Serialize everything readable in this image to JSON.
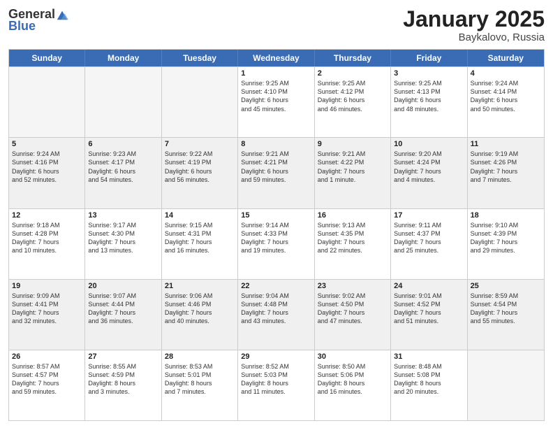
{
  "header": {
    "logo_general": "General",
    "logo_blue": "Blue",
    "month": "January 2025",
    "location": "Baykalovo, Russia"
  },
  "days_of_week": [
    "Sunday",
    "Monday",
    "Tuesday",
    "Wednesday",
    "Thursday",
    "Friday",
    "Saturday"
  ],
  "weeks": [
    [
      {
        "day": "",
        "info": "",
        "empty": true
      },
      {
        "day": "",
        "info": "",
        "empty": true
      },
      {
        "day": "",
        "info": "",
        "empty": true
      },
      {
        "day": "1",
        "info": "Sunrise: 9:25 AM\nSunset: 4:10 PM\nDaylight: 6 hours\nand 45 minutes."
      },
      {
        "day": "2",
        "info": "Sunrise: 9:25 AM\nSunset: 4:12 PM\nDaylight: 6 hours\nand 46 minutes."
      },
      {
        "day": "3",
        "info": "Sunrise: 9:25 AM\nSunset: 4:13 PM\nDaylight: 6 hours\nand 48 minutes."
      },
      {
        "day": "4",
        "info": "Sunrise: 9:24 AM\nSunset: 4:14 PM\nDaylight: 6 hours\nand 50 minutes."
      }
    ],
    [
      {
        "day": "5",
        "info": "Sunrise: 9:24 AM\nSunset: 4:16 PM\nDaylight: 6 hours\nand 52 minutes."
      },
      {
        "day": "6",
        "info": "Sunrise: 9:23 AM\nSunset: 4:17 PM\nDaylight: 6 hours\nand 54 minutes."
      },
      {
        "day": "7",
        "info": "Sunrise: 9:22 AM\nSunset: 4:19 PM\nDaylight: 6 hours\nand 56 minutes."
      },
      {
        "day": "8",
        "info": "Sunrise: 9:21 AM\nSunset: 4:21 PM\nDaylight: 6 hours\nand 59 minutes."
      },
      {
        "day": "9",
        "info": "Sunrise: 9:21 AM\nSunset: 4:22 PM\nDaylight: 7 hours\nand 1 minute."
      },
      {
        "day": "10",
        "info": "Sunrise: 9:20 AM\nSunset: 4:24 PM\nDaylight: 7 hours\nand 4 minutes."
      },
      {
        "day": "11",
        "info": "Sunrise: 9:19 AM\nSunset: 4:26 PM\nDaylight: 7 hours\nand 7 minutes."
      }
    ],
    [
      {
        "day": "12",
        "info": "Sunrise: 9:18 AM\nSunset: 4:28 PM\nDaylight: 7 hours\nand 10 minutes."
      },
      {
        "day": "13",
        "info": "Sunrise: 9:17 AM\nSunset: 4:30 PM\nDaylight: 7 hours\nand 13 minutes."
      },
      {
        "day": "14",
        "info": "Sunrise: 9:15 AM\nSunset: 4:31 PM\nDaylight: 7 hours\nand 16 minutes."
      },
      {
        "day": "15",
        "info": "Sunrise: 9:14 AM\nSunset: 4:33 PM\nDaylight: 7 hours\nand 19 minutes."
      },
      {
        "day": "16",
        "info": "Sunrise: 9:13 AM\nSunset: 4:35 PM\nDaylight: 7 hours\nand 22 minutes."
      },
      {
        "day": "17",
        "info": "Sunrise: 9:11 AM\nSunset: 4:37 PM\nDaylight: 7 hours\nand 25 minutes."
      },
      {
        "day": "18",
        "info": "Sunrise: 9:10 AM\nSunset: 4:39 PM\nDaylight: 7 hours\nand 29 minutes."
      }
    ],
    [
      {
        "day": "19",
        "info": "Sunrise: 9:09 AM\nSunset: 4:41 PM\nDaylight: 7 hours\nand 32 minutes."
      },
      {
        "day": "20",
        "info": "Sunrise: 9:07 AM\nSunset: 4:44 PM\nDaylight: 7 hours\nand 36 minutes."
      },
      {
        "day": "21",
        "info": "Sunrise: 9:06 AM\nSunset: 4:46 PM\nDaylight: 7 hours\nand 40 minutes."
      },
      {
        "day": "22",
        "info": "Sunrise: 9:04 AM\nSunset: 4:48 PM\nDaylight: 7 hours\nand 43 minutes."
      },
      {
        "day": "23",
        "info": "Sunrise: 9:02 AM\nSunset: 4:50 PM\nDaylight: 7 hours\nand 47 minutes."
      },
      {
        "day": "24",
        "info": "Sunrise: 9:01 AM\nSunset: 4:52 PM\nDaylight: 7 hours\nand 51 minutes."
      },
      {
        "day": "25",
        "info": "Sunrise: 8:59 AM\nSunset: 4:54 PM\nDaylight: 7 hours\nand 55 minutes."
      }
    ],
    [
      {
        "day": "26",
        "info": "Sunrise: 8:57 AM\nSunset: 4:57 PM\nDaylight: 7 hours\nand 59 minutes."
      },
      {
        "day": "27",
        "info": "Sunrise: 8:55 AM\nSunset: 4:59 PM\nDaylight: 8 hours\nand 3 minutes."
      },
      {
        "day": "28",
        "info": "Sunrise: 8:53 AM\nSunset: 5:01 PM\nDaylight: 8 hours\nand 7 minutes."
      },
      {
        "day": "29",
        "info": "Sunrise: 8:52 AM\nSunset: 5:03 PM\nDaylight: 8 hours\nand 11 minutes."
      },
      {
        "day": "30",
        "info": "Sunrise: 8:50 AM\nSunset: 5:06 PM\nDaylight: 8 hours\nand 16 minutes."
      },
      {
        "day": "31",
        "info": "Sunrise: 8:48 AM\nSunset: 5:08 PM\nDaylight: 8 hours\nand 20 minutes."
      },
      {
        "day": "",
        "info": "",
        "empty": true
      }
    ]
  ]
}
